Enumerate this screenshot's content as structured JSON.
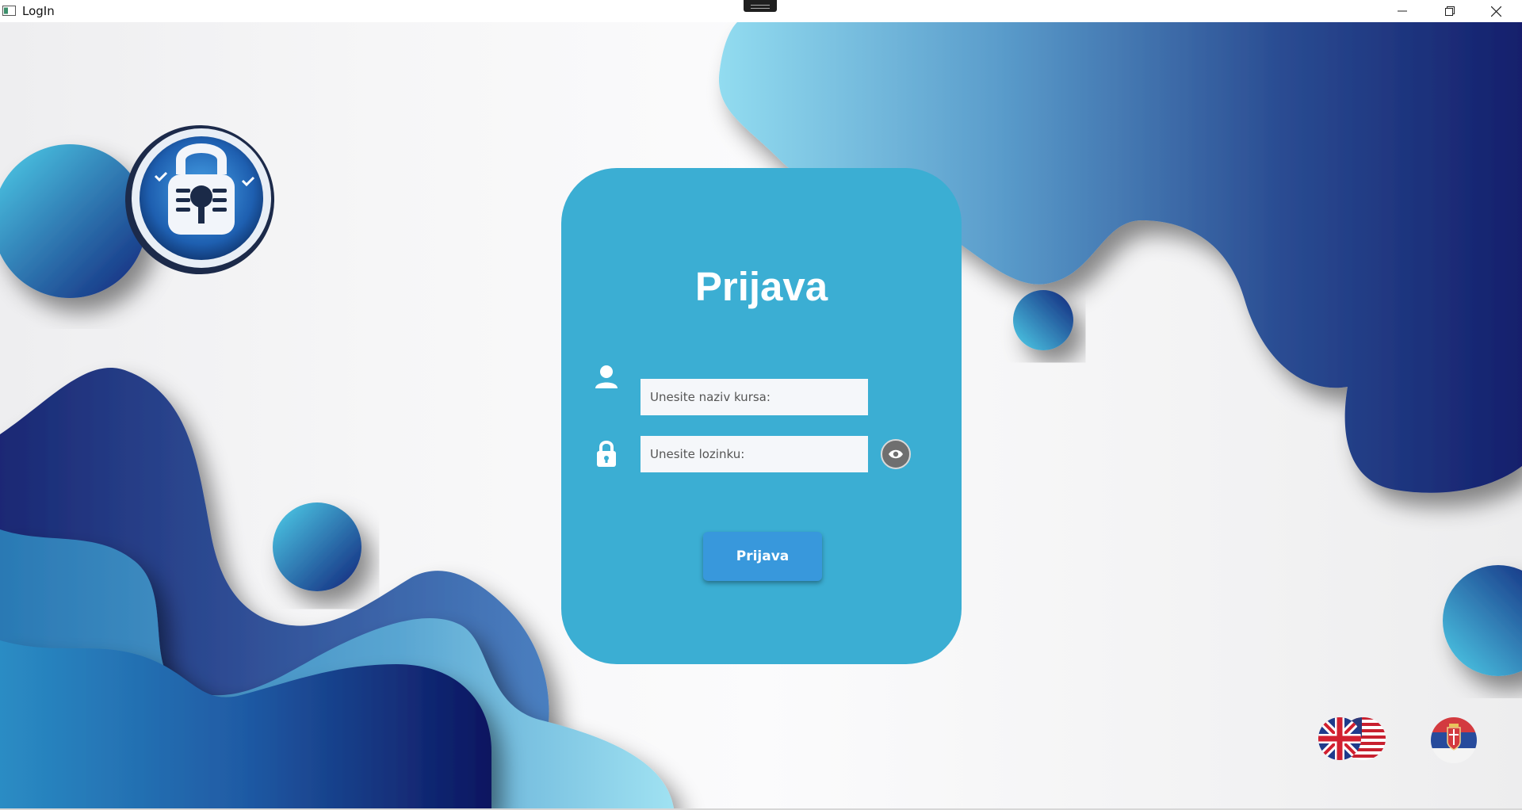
{
  "window": {
    "title": "LogIn",
    "controls": [
      "minimize-icon",
      "restore-icon",
      "close-icon"
    ]
  },
  "login": {
    "title": "Prijava",
    "username_placeholder": "Unesite naziv kursa:",
    "username_value": "",
    "password_placeholder": "Unesite lozinku:",
    "password_value": "",
    "submit_label": "Prijava"
  },
  "icons": {
    "user": "user-icon",
    "lock": "lock-icon",
    "show_password": "eye-icon",
    "logo": "padlock-logo-icon"
  },
  "languages": [
    {
      "name": "english-flag-icon",
      "flags": "uk-us"
    },
    {
      "name": "serbian-flag-icon",
      "flags": "serbia"
    }
  ],
  "colors": {
    "card": "#3baed3",
    "button": "#3898dc",
    "input_bg": "#f5f7fa",
    "wave_dark": "#12206e",
    "wave_light": "#8bd8ec"
  }
}
